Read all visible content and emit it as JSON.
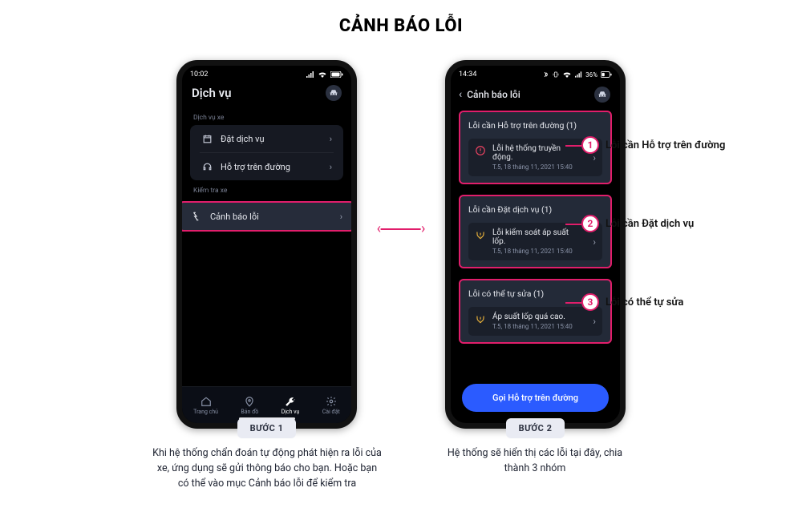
{
  "page_title": "CẢNH BÁO LỖI",
  "screen1": {
    "time": "10:02",
    "title": "Dịch vụ",
    "section_vehicle": "Dịch vụ xe",
    "row_book": "Đặt dịch vụ",
    "row_roadside": "Hỗ trợ trên đường",
    "section_check": "Kiểm tra xe",
    "row_fault": "Cảnh báo lỗi",
    "nav": {
      "home": "Trang chủ",
      "map": "Bản đồ",
      "service": "Dịch vụ",
      "settings": "Cài đặt"
    }
  },
  "screen2": {
    "time": "14:34",
    "battery": "36%",
    "title": "Cảnh báo lỗi",
    "cards": [
      {
        "title": "Lỗi cần Hỗ trợ trên đường (1)",
        "item_name": "Lỗi hệ thống truyền động.",
        "item_time": "T.5, 18 tháng 11, 2021 15:40"
      },
      {
        "title": "Lỗi cần Đặt dịch vụ (1)",
        "item_name": "Lỗi kiểm soát áp suất lốp.",
        "item_time": "T.5, 18 tháng 11, 2021 15:40"
      },
      {
        "title": "Lỗi có thể tự sửa (1)",
        "item_name": "Áp suất lốp quá cao.",
        "item_time": "T.5, 18 tháng 11, 2021 15:40"
      }
    ],
    "cta": "Gọi Hỗ trợ trên đường"
  },
  "callouts": [
    "Lỗi cần Hỗ trợ trên đường",
    "Lỗi cần Đặt dịch vụ",
    "Lỗi có thể tự sửa"
  ],
  "steps": {
    "step1_label": "BƯỚC 1",
    "step1_desc": "Khi hệ thống chẩn đoán tự động phát hiện ra lỗi của xe, ứng dụng sẽ gửi thông báo cho bạn. Hoặc bạn có thể vào mục Cảnh báo lỗi để kiểm tra",
    "step2_label": "BƯỚC 2",
    "step2_desc": "Hệ thống sẽ hiển thị các lỗi tại đây, chia thành 3 nhóm"
  },
  "numbers": {
    "n1": "1",
    "n2": "2",
    "n3": "3"
  }
}
